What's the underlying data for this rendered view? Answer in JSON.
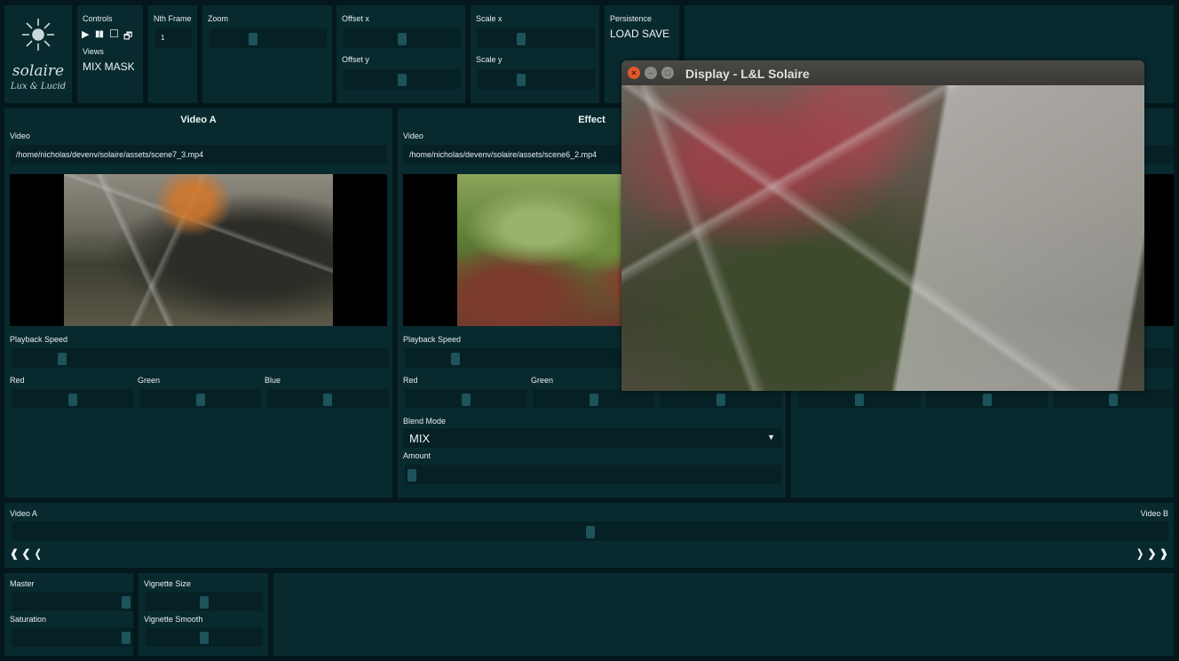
{
  "logo": {
    "name": "solaire",
    "tagline": "Lux & Lucid"
  },
  "controls": {
    "label": "Controls",
    "views_label": "Views",
    "views_value": "MIX MASK",
    "play_glyph": "▶",
    "pause_glyph": "▮▮",
    "window_glyph": "☐",
    "restore_glyph": "🗗"
  },
  "nth_frame": {
    "label": "Nth Frame",
    "value": "1"
  },
  "zoom": {
    "label": "Zoom",
    "level": 0.35
  },
  "offset": {
    "x_label": "Offset x",
    "y_label": "Offset y",
    "x_level": 0.5,
    "y_level": 0.5
  },
  "scale": {
    "x_label": "Scale x",
    "y_label": "Scale y",
    "x_level": 0.35,
    "y_level": 0.35
  },
  "persistence": {
    "label": "Persistence",
    "value": "LOAD SAVE"
  },
  "video_a": {
    "title": "Video A",
    "video_label": "Video",
    "path": "/home/nicholas/devenv/solaire/assets/scene7_3.mp4",
    "playback_label": "Playback Speed",
    "playback_level": 0.12,
    "red_label": "Red",
    "green_label": "Green",
    "blue_label": "Blue",
    "red_level": 0.5,
    "green_level": 0.5,
    "blue_level": 0.5
  },
  "effect": {
    "title": "Effect",
    "video_label": "Video",
    "path": "/home/nicholas/devenv/solaire/assets/scene6_2.mp4",
    "playback_label": "Playback Speed",
    "playback_level": 0.12,
    "red_label": "Red",
    "green_label": "Green",
    "red_level": 0.5,
    "green_level": 0.5,
    "blue_level": 0.5,
    "blend_label": "Blend Mode",
    "blend_value": "MIX",
    "amount_label": "Amount",
    "amount_level": 0.0
  },
  "video_b": {
    "red_level": 0.5,
    "green_level": 0.5,
    "blue_level": 0.5
  },
  "crossfade": {
    "left_label": "Video A",
    "right_label": "Video B",
    "level": 0.5,
    "left_arrows": "❰ ❮ ❬",
    "right_arrows": "❭ ❯ ❱"
  },
  "master": {
    "label": "Master",
    "level": 1.0
  },
  "saturation": {
    "label": "Saturation",
    "level": 1.0
  },
  "vignette_size": {
    "label": "Vignette Size",
    "level": 0.5
  },
  "vignette_smooth": {
    "label": "Vignette Smooth",
    "level": 0.5
  },
  "display_window": {
    "title": "Display - L&L Solaire",
    "close_glyph": "×",
    "minimize_glyph": "–",
    "maximize_glyph": "□"
  }
}
